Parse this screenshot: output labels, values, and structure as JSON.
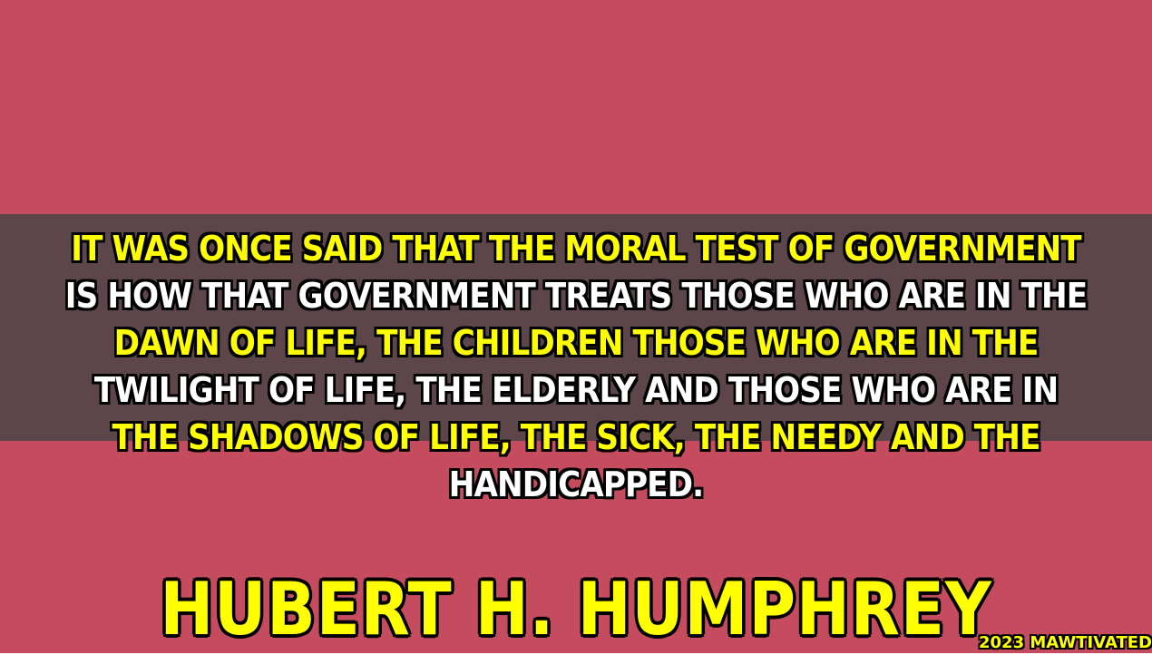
{
  "colors": {
    "background": "#c44c5e",
    "band": "#4a4546",
    "yellow": "#ffff00",
    "white": "#ffffff"
  },
  "quote": {
    "lines": [
      {
        "text": "IT WAS ONCE SAID THAT THE MORAL TEST OF GOVERNMENT",
        "color": "#ffff00"
      },
      {
        "text": "IS HOW THAT GOVERNMENT TREATS THOSE WHO ARE IN THE",
        "color": "#ffffff"
      },
      {
        "text": "DAWN OF LIFE, THE CHILDREN THOSE WHO ARE IN THE",
        "color": "#ffff00"
      },
      {
        "text": "TWILIGHT OF LIFE, THE ELDERLY AND THOSE WHO ARE IN",
        "color": "#ffffff"
      },
      {
        "text": "THE SHADOWS OF LIFE, THE SICK, THE NEEDY AND THE",
        "color": "#ffff00"
      },
      {
        "text": "HANDICAPPED.",
        "color": "#ffffff"
      }
    ]
  },
  "author": {
    "name": "HUBERT H. HUMPHREY",
    "color": "#ffff00"
  },
  "watermark": {
    "text": "2023 MAWTIVATED",
    "color": "#ffff00"
  }
}
